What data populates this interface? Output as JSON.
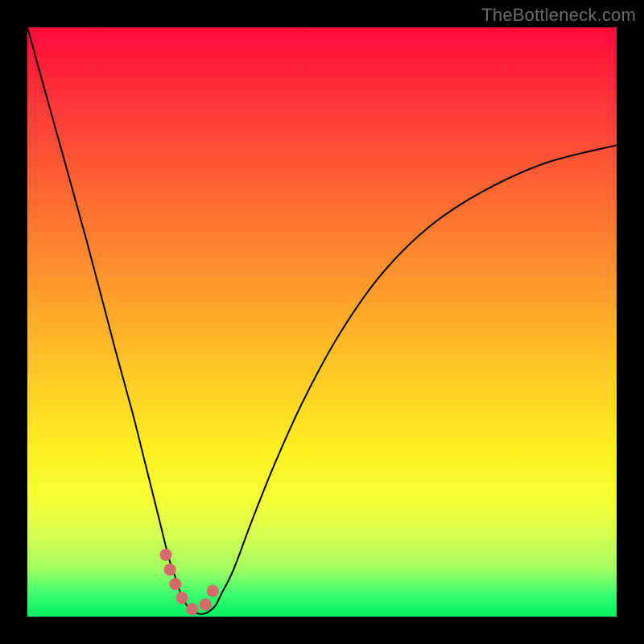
{
  "watermark": "TheBottleneck.com",
  "chart_data": {
    "type": "line",
    "title": "",
    "xlabel": "",
    "ylabel": "",
    "xlim": [
      0,
      100
    ],
    "ylim": [
      0,
      100
    ],
    "grid": false,
    "legend": false,
    "series": [
      {
        "name": "curve",
        "color": "#000000",
        "x": [
          0,
          5,
          10,
          15,
          18,
          20,
          22,
          24,
          25,
          26,
          27,
          28,
          29,
          30,
          31,
          32,
          33,
          35,
          38,
          42,
          47,
          53,
          60,
          68,
          77,
          88,
          100
        ],
        "values": [
          100,
          82,
          64,
          45,
          34,
          26,
          18,
          10,
          7,
          4,
          2,
          1,
          0.5,
          0.5,
          1,
          2,
          4,
          8,
          16,
          26,
          37,
          48,
          58,
          66,
          72,
          77,
          80
        ]
      },
      {
        "name": "highlight",
        "color": "#d46a6a",
        "x": [
          23.5,
          24.2,
          25.0,
          25.8,
          26.6,
          27.4,
          28.2,
          29.0,
          29.8,
          30.6,
          31.4,
          32.0
        ],
        "values": [
          10.5,
          8.0,
          5.8,
          4.0,
          2.6,
          1.6,
          1.2,
          1.2,
          1.6,
          2.6,
          4.2,
          6.0
        ]
      }
    ],
    "annotation": "Vertical gradient background encodes value from red (high) to green (low); black V-curve dips to minimum near x≈29; salmon dotted marker highlights the valley."
  }
}
